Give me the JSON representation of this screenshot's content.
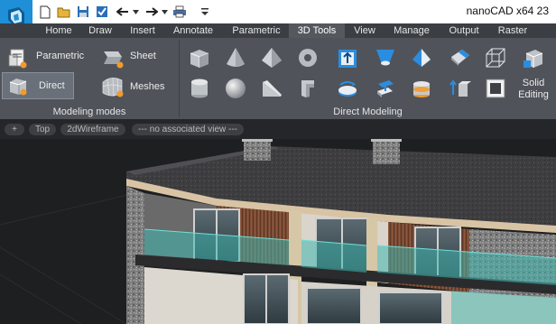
{
  "app": {
    "title": "nanoCAD x64 23"
  },
  "quick_access": {
    "items": [
      "new-file",
      "open-file",
      "save",
      "save-as",
      "undo",
      "redo",
      "print",
      "customize"
    ]
  },
  "tabs": [
    {
      "label": "Home"
    },
    {
      "label": "Draw"
    },
    {
      "label": "Insert"
    },
    {
      "label": "Annotate"
    },
    {
      "label": "Parametric"
    },
    {
      "label": "3D Tools",
      "active": true
    },
    {
      "label": "View"
    },
    {
      "label": "Manage"
    },
    {
      "label": "Output"
    },
    {
      "label": "Raster"
    }
  ],
  "ribbon": {
    "modeling_modes": {
      "label": "Modeling modes",
      "parametric": "Parametric",
      "direct": "Direct",
      "sheet": "Sheet",
      "meshes": "Meshes"
    },
    "direct_modeling": {
      "label": "Direct Modeling",
      "solid_editing": "Solid\nEditing"
    }
  },
  "viewport": {
    "controls": [
      "+",
      "Top",
      "2dWireframe",
      "--- no associated view ---"
    ]
  },
  "colors": {
    "accent": "#1f8fd8",
    "ribbon": "#50545a",
    "tabbar": "#3b3e42",
    "active_tab": "#55595e"
  }
}
